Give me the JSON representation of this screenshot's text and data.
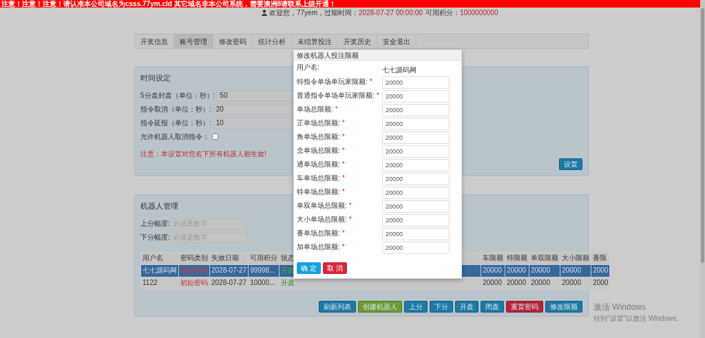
{
  "notice_bar": {
    "text": "注意！注意！注意！请认准本公司域名为csss.77ym.cld 其它域名非本公司系统，需要澳洲8请联系上级开通！"
  },
  "welcome": {
    "greeting": "欢迎您，77yem，过期时间：",
    "expiry": "2028-07-27 00:00:00",
    "points_label": "可用积分：",
    "points": "1000000000"
  },
  "nav_tabs": [
    {
      "label": "开奖信息",
      "selected": false
    },
    {
      "label": "账号管理",
      "selected": true
    },
    {
      "label": "修改密码",
      "selected": false
    },
    {
      "label": "统计分析",
      "selected": false
    },
    {
      "label": "未结算投注",
      "selected": false
    },
    {
      "label": "开奖历史",
      "selected": false
    },
    {
      "label": "安全退出",
      "selected": false
    }
  ],
  "time_settings": {
    "title": "时间设定",
    "fields": [
      {
        "label": "5分盘封盘（单位：秒）:",
        "value": "50"
      },
      {
        "label": "指令取消（单位：秒）:",
        "value": "20"
      },
      {
        "label": "指令延报（单位：秒）:",
        "value": "10"
      }
    ],
    "checkbox": {
      "label": "允许机器人取消指令：",
      "checked": false
    },
    "note": "注意：本设置对您名下所有机器人都生效!",
    "button": "设置"
  },
  "robot_management": {
    "title": "机器人管理",
    "fields": [
      {
        "label": "上分幅度:",
        "placeholder": "必须是数字"
      },
      {
        "label": "下分幅度:",
        "placeholder": "必须是数字"
      }
    ],
    "table": {
      "left_columns": [
        {
          "label": "用户名",
          "kind": "plain"
        },
        {
          "label": "密码类别",
          "kind": "password"
        },
        {
          "label": "失效日期",
          "kind": "plain"
        },
        {
          "label": "可用积分",
          "kind": "plain"
        },
        {
          "label": "状态",
          "kind": "status"
        }
      ],
      "right_columns": [
        {
          "label": "车限额"
        },
        {
          "label": "特限额"
        },
        {
          "label": "单双限额"
        },
        {
          "label": "大小限额"
        },
        {
          "label": "番限"
        }
      ],
      "rows": [
        {
          "selected": true,
          "left_cells": [
            "七七源码网",
            "初始密码",
            "2028-07-27",
            "99998...",
            "开盘"
          ],
          "right_cells": [
            "20000",
            "20000",
            "20000",
            "20000",
            "2000"
          ]
        },
        {
          "selected": false,
          "left_cells": [
            "1122",
            "初始密码",
            "2028-07-27",
            "10000...",
            "开盘"
          ],
          "right_cells": [
            "20000",
            "20000",
            "20000",
            "20000",
            "2000"
          ]
        }
      ]
    },
    "buttons": [
      {
        "label": "刷新列表",
        "kind": "primary"
      },
      {
        "label": "创建机器人",
        "kind": "success"
      },
      {
        "label": "上分",
        "kind": "primary"
      },
      {
        "label": "下分",
        "kind": "primary"
      },
      {
        "label": "开盘",
        "kind": "primary"
      },
      {
        "label": "闭盘",
        "kind": "primary"
      },
      {
        "label": "重置密码",
        "kind": "danger"
      },
      {
        "label": "修改限额",
        "kind": "primary"
      }
    ]
  },
  "modal": {
    "title": "修改机器人投注限额",
    "username_label": "用户名:",
    "username": "七七源码网",
    "fields": [
      {
        "label": "特指令单场单玩家限额:",
        "required_mark": "*",
        "value": "20000"
      },
      {
        "label": "普通指令单场单玩家限额:",
        "required_mark": "*",
        "value": "20000"
      },
      {
        "label": "单场总限额:",
        "required_mark": "*",
        "value": "20000"
      },
      {
        "label": "正单场总限额:",
        "required_mark": "*",
        "value": "20000"
      },
      {
        "label": "角单场总限额:",
        "required_mark": "*",
        "value": "20000"
      },
      {
        "label": "念单场总限额:",
        "required_mark": "*",
        "value": "20000"
      },
      {
        "label": "通单场总限额:",
        "required_mark": "*",
        "value": "20000"
      },
      {
        "label": "车单场总限额:",
        "required_mark": "*",
        "value": "20000"
      },
      {
        "label": "特单场总限额:",
        "required_mark": "*",
        "value": "20000"
      },
      {
        "label": "单双单场总限额:",
        "required_mark": "*",
        "value": "20000"
      },
      {
        "label": "大小单场总限额:",
        "required_mark": "*",
        "value": "20000"
      },
      {
        "label": "番单场总限额:",
        "required_mark": "*",
        "value": "20000"
      },
      {
        "label": "加单场总限额:",
        "required_mark": "*",
        "value": "20000"
      }
    ],
    "buttons": [
      {
        "label": "确 定",
        "kind": "primary"
      },
      {
        "label": "取 消",
        "kind": "danger"
      }
    ]
  },
  "os_notice": {
    "title": "激活 Windows",
    "subtitle": "转到\"设置\"以激活 Windows。"
  }
}
